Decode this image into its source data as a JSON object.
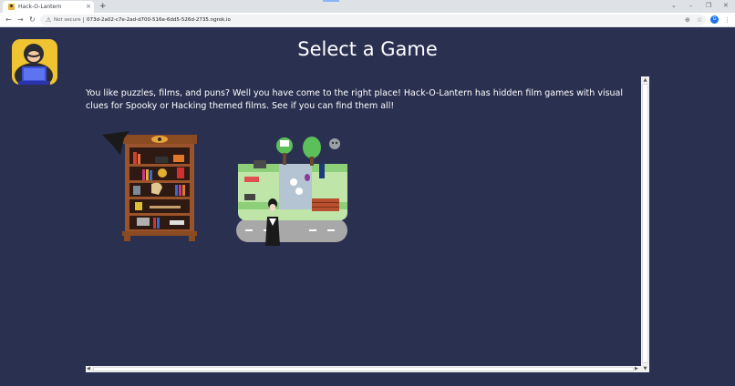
{
  "browser": {
    "tab_title": "Hack-O-Lantern",
    "tab_close": "×",
    "new_tab": "+",
    "window_controls": [
      "⌄",
      "–",
      "❐",
      "✕"
    ],
    "security_label": "Not secure",
    "url": "073d-2a02-c7e-2ad-d700-516e-6dd5-526d-2735.ngrok.io",
    "profile_initial": "G",
    "nav": {
      "back": "←",
      "forward": "→",
      "reload": "↻"
    },
    "toolbar_icons": {
      "zoom": "⊕",
      "bookmark": "☆",
      "menu": "⋮"
    }
  },
  "page": {
    "title": "Select a Game",
    "intro": "You like puzzles, films, and puns? Well you have come to the right place! Hack-O-Lantern has hidden film games with visual clues for Spooky or Hacking themed films. See if you can find them all!",
    "games": [
      {
        "theme": "Spooky",
        "icon": "haunted-bookshelf-icon"
      },
      {
        "theme": "Hacking",
        "icon": "hacking-town-map-icon"
      }
    ]
  },
  "colors": {
    "page_background": "#2a3050",
    "logo_background": "#f0c330",
    "text": "#ffffff"
  }
}
